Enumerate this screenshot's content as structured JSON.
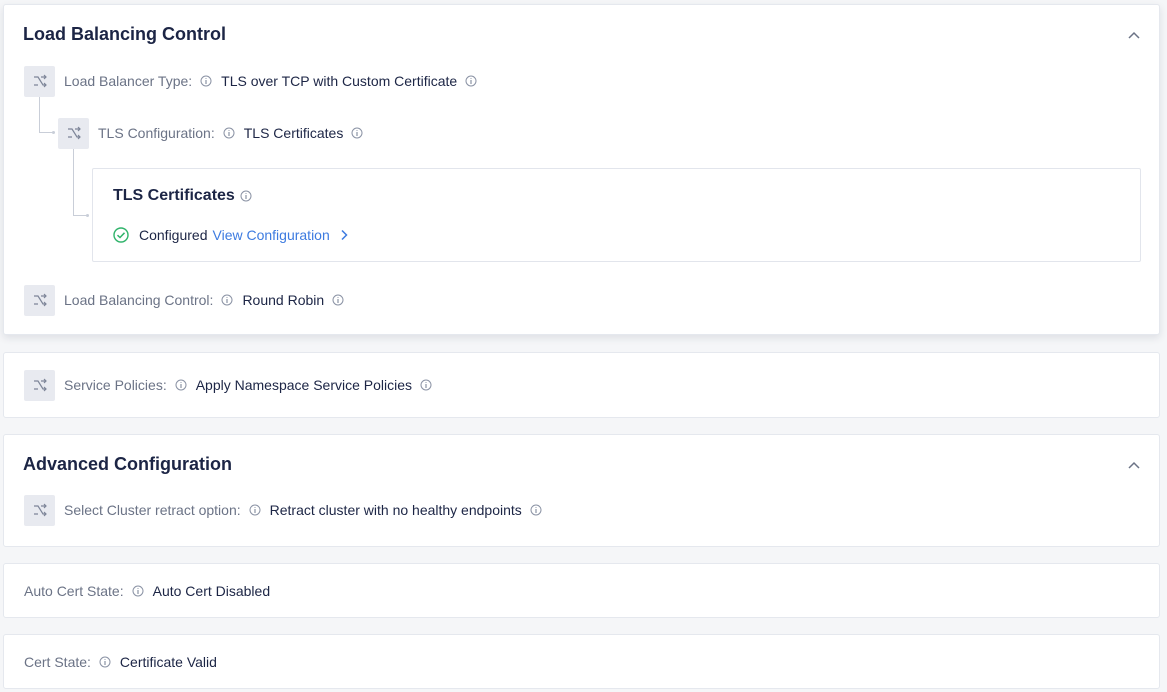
{
  "lb_section": {
    "title": "Load Balancing Control",
    "rows": {
      "lb_type": {
        "label": "Load Balancer Type:",
        "value": "TLS over TCP with Custom Certificate"
      },
      "tls_config": {
        "label": "TLS Configuration:",
        "value": "TLS Certificates"
      },
      "lb_control": {
        "label": "Load Balancing Control:",
        "value": "Round Robin"
      }
    },
    "tls_box": {
      "title": "TLS Certificates",
      "status": "Configured",
      "link": "View Configuration"
    }
  },
  "service_policies": {
    "label": "Service Policies:",
    "value": "Apply Namespace Service Policies"
  },
  "advanced": {
    "title": "Advanced Configuration",
    "retract": {
      "label": "Select Cluster retract option:",
      "value": "Retract cluster with no healthy endpoints"
    }
  },
  "auto_cert": {
    "label": "Auto Cert State:",
    "value": "Auto Cert Disabled"
  },
  "cert_state": {
    "label": "Cert State:",
    "value": "Certificate Valid"
  },
  "colors": {
    "accent": "#3d7be0",
    "success": "#2fb36a",
    "title": "#1c2545",
    "label": "#6b7386"
  }
}
